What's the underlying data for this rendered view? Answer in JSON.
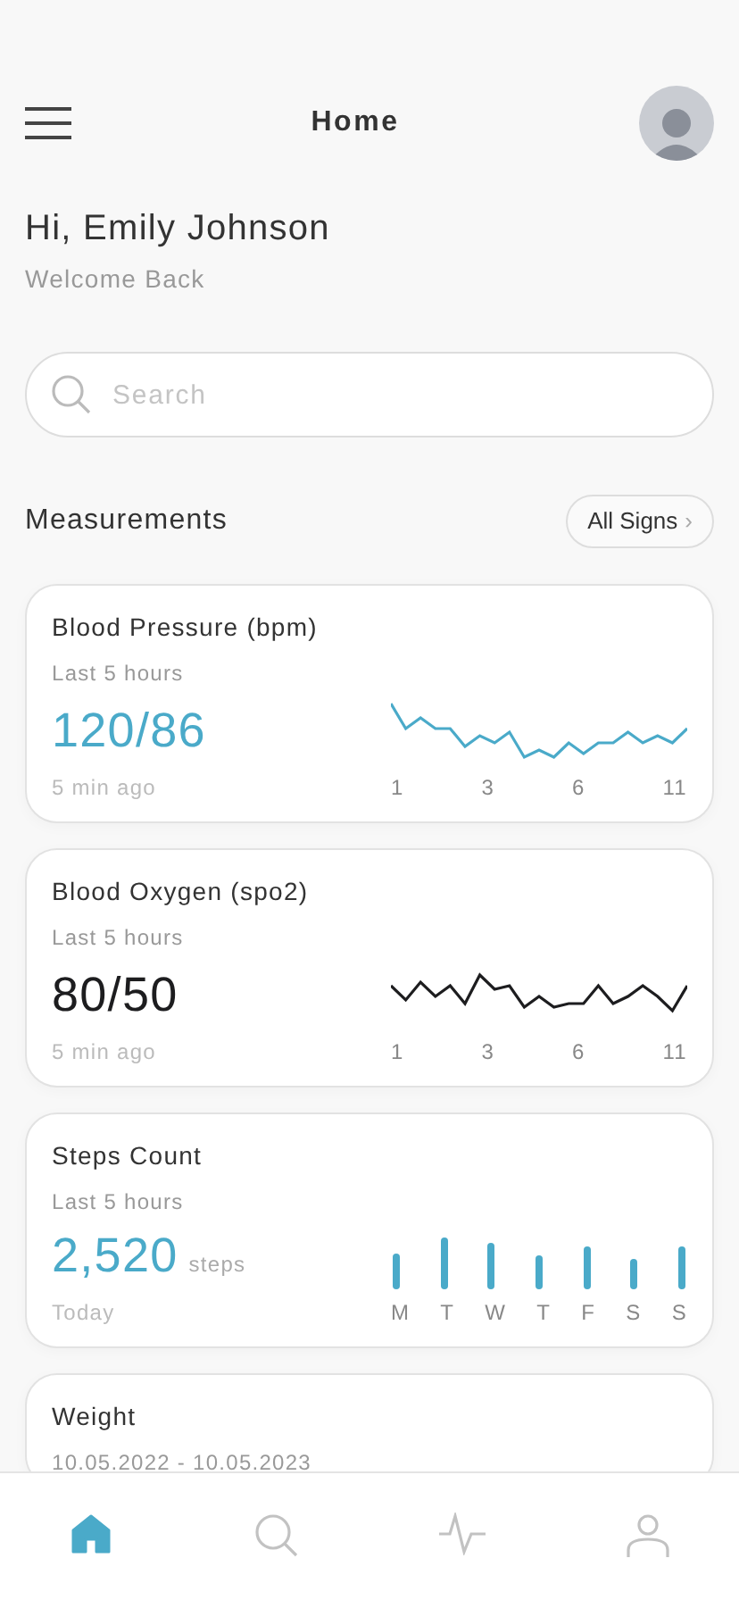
{
  "header": {
    "title": "Home"
  },
  "greeting": {
    "title": "Hi, Emily Johnson",
    "subtitle": "Welcome Back"
  },
  "search": {
    "placeholder": "Search"
  },
  "section": {
    "title": "Measurements",
    "button": "All Signs",
    "button_icon": "›"
  },
  "measurements": [
    {
      "kind": "line",
      "title": "Blood Pressure (bpm)",
      "period": "Last 5 hours",
      "value": "120/86",
      "color": "#4aaac9",
      "footer": "5 min ago",
      "x_labels": [
        "1",
        "3",
        "6",
        "11"
      ]
    },
    {
      "kind": "line",
      "title": "Blood Oxygen (spo2)",
      "period": "Last 5 hours",
      "value": "80/50",
      "color": "#1d1d1f",
      "footer": "5 min ago",
      "x_labels": [
        "1",
        "3",
        "6",
        "11"
      ]
    },
    {
      "kind": "bars",
      "title": "Steps Count",
      "period": "Last 5 hours",
      "value": "2,520",
      "unit": "steps",
      "color": "#4aaac9",
      "footer": "Today",
      "x_labels": [
        "M",
        "T",
        "W",
        "T",
        "F",
        "S",
        "S"
      ]
    },
    {
      "kind": "partial",
      "title": "Weight",
      "period": "10.05.2022 - 10.05.2023"
    }
  ],
  "bottom_nav": [
    {
      "kind": "home",
      "selected": true
    },
    {
      "kind": "search",
      "selected": false
    },
    {
      "kind": "activity",
      "selected": false
    },
    {
      "kind": "person",
      "selected": false
    }
  ]
}
